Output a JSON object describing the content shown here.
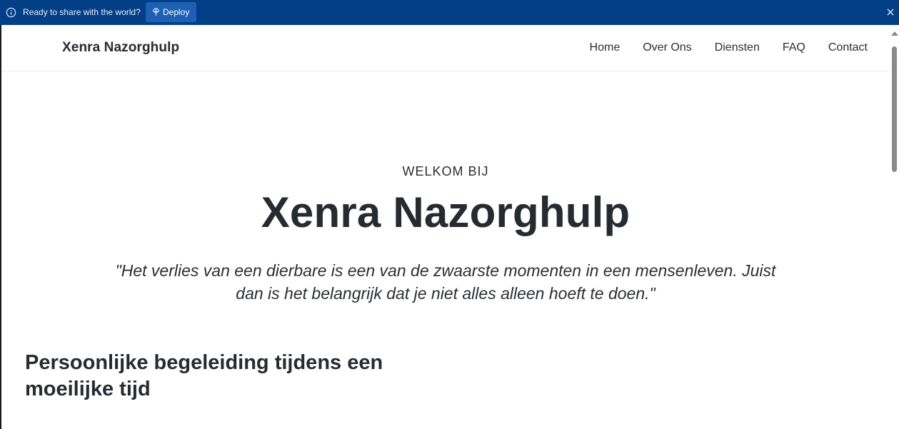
{
  "banner": {
    "text": "Ready to share with the world?",
    "deploy_label": "Deploy",
    "background": "#023f86"
  },
  "navbar": {
    "brand": "Xenra Nazorghulp",
    "links": [
      {
        "label": "Home"
      },
      {
        "label": "Over Ons"
      },
      {
        "label": "Diensten"
      },
      {
        "label": "FAQ"
      },
      {
        "label": "Contact"
      }
    ]
  },
  "hero": {
    "kicker": "WELKOM BIJ",
    "title": "Xenra Nazorghulp",
    "quote": "\"Het verlies van een dierbare is een van de zwaarste momenten in een mensenleven. Juist dan is het belangrijk dat je niet alles alleen hoeft te doen.\""
  },
  "section": {
    "heading": "Persoonlijke begeleiding tijdens een moeilijke tijd"
  },
  "icons": {
    "info": "info-icon",
    "deploy": "deploy-icon",
    "close": "close-icon"
  }
}
